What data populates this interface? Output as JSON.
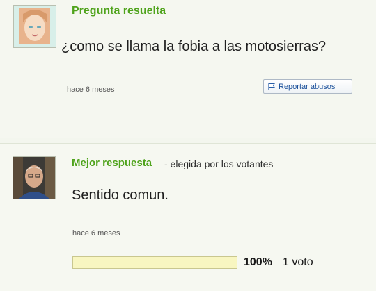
{
  "question": {
    "header": "Pregunta resuelta",
    "text": "¿como se llama la fobia a las motosierras?",
    "timestamp": "hace 6 meses",
    "report_label": "Reportar abusos",
    "avatar_icon": "user-avatar-cartoon-girl"
  },
  "answer": {
    "header": "Mejor respuesta",
    "chosen_by": "- elegida por los votantes",
    "text": "Sentido comun.",
    "timestamp": "hace 6 meses",
    "vote_percent_label": "100%",
    "vote_count_label": "1 voto",
    "vote_fraction": 1.0,
    "avatar_icon": "user-avatar-photo-man"
  },
  "colors": {
    "header_green": "#4fa31c",
    "link_blue": "#1a4f9a",
    "bar_yellow": "#fbfad2"
  }
}
